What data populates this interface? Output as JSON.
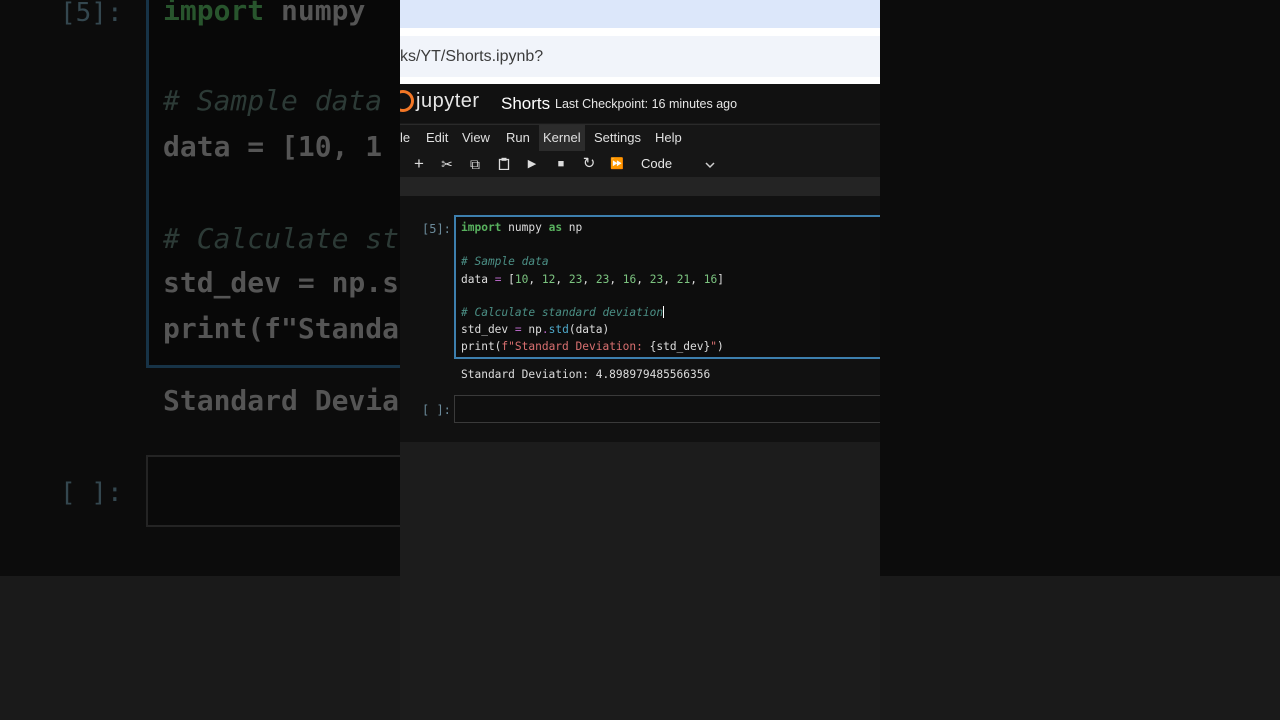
{
  "browser": {
    "url": "ks/YT/Shorts.ipynb?"
  },
  "jupyter": {
    "logo_text": "jupyter",
    "notebook_name": "Shorts",
    "checkpoint": "Last Checkpoint: 16 minutes ago"
  },
  "menu": {
    "items": [
      "le",
      "Edit",
      "View",
      "Run",
      "Kernel",
      "Settings",
      "Help"
    ],
    "active": "Kernel"
  },
  "toolbar": {
    "add": "+",
    "cut": "✂",
    "copy": "⧉",
    "paste": "📋",
    "run": "▶",
    "stop": "■",
    "restart": "↻",
    "run_all": "⏩",
    "cell_type": "Code",
    "icons": [
      "plus-icon",
      "cut-icon",
      "copy-icon",
      "paste-icon",
      "run-icon",
      "stop-icon",
      "restart-icon",
      "fast-forward-icon",
      "chevron-down-icon"
    ]
  },
  "cells": [
    {
      "prompt": "[5]:",
      "code": {
        "l1_kw1": "import",
        "l1_mod": " numpy ",
        "l1_kw2": "as",
        "l1_alias": " np",
        "l2_comment": "# Sample data",
        "l3_var": "data ",
        "l3_op": "=",
        "l3_list_open": " [",
        "l3_values": [
          "10",
          "12",
          "23",
          "23",
          "16",
          "23",
          "21",
          "16"
        ],
        "l3_list_close": "]",
        "l4_comment": "# Calculate standard deviation",
        "l5_var": "std_dev ",
        "l5_op": "=",
        "l5_obj": " np",
        "l5_dot": ".",
        "l5_fn": "std",
        "l5_args": "(data)",
        "l6_fn": "print(",
        "l6_str": "f\"Standard Deviation: ",
        "l6_interp": "{std_dev}",
        "l6_str_end": "\"",
        "l6_close": ")"
      },
      "output": "Standard Deviation: 4.898979485566356"
    },
    {
      "prompt": "[ ]:"
    }
  ],
  "backdrop": {
    "prompt_top": "[5]:",
    "prompt_bottom": "[ ]:",
    "line1_kw": "import",
    "line1_rest": " numpy ",
    "line2": "# Sample data",
    "line3": "data = [10, 1",
    "line4": "# Calculate st",
    "line5": "std_dev = np.s",
    "line6": "print(f\"Standa",
    "output": "Standard Devia"
  }
}
